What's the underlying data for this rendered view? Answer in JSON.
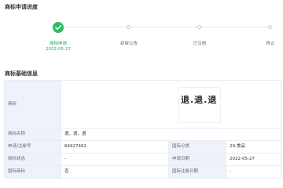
{
  "progress": {
    "title": "商标申请进度",
    "steps": [
      {
        "label": "商标申请",
        "date": "2022-05-27",
        "done": true
      },
      {
        "label": "初审公告",
        "done": false
      },
      {
        "label": "已注册",
        "done": false
      },
      {
        "label": "终止",
        "done": false
      }
    ]
  },
  "basic_info": {
    "title": "商标基础信息",
    "mark_label": "商标",
    "mark_text": "退.退.退",
    "rows": [
      {
        "k1": "商标名称",
        "v1": "退，退，退"
      },
      {
        "k1": "申请/注册号",
        "v1": "64927462",
        "k2": "国际分类",
        "v2": "29-食品"
      },
      {
        "k1": "商标状态",
        "v1": "-",
        "k2": "申请日期",
        "v2": "2022-05-27"
      },
      {
        "k1": "国际商标",
        "v1": "否",
        "k2": "国际注册日期",
        "v2": "-"
      }
    ]
  },
  "colors": {
    "accent_green": "#28c05a",
    "label_bg": "#eef3fb"
  }
}
